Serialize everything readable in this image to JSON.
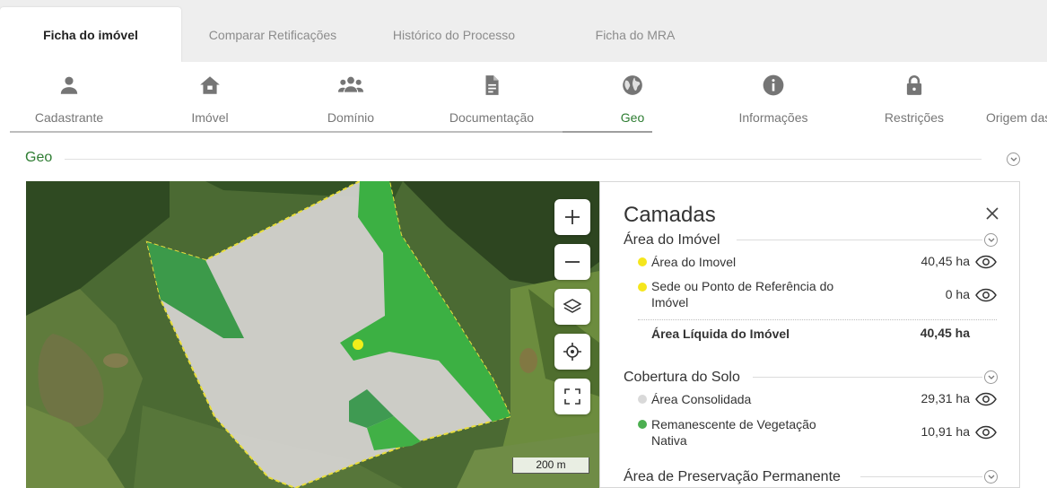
{
  "top_tabs": [
    {
      "label": "Ficha do imóvel",
      "active": true
    },
    {
      "label": "Comparar Retificações",
      "active": false
    },
    {
      "label": "Histórico do Processo",
      "active": false
    },
    {
      "label": "Ficha do MRA",
      "active": false
    }
  ],
  "nav": {
    "items": [
      {
        "label": "Cadastrante",
        "icon": "person-icon"
      },
      {
        "label": "Imóvel",
        "icon": "home-icon"
      },
      {
        "label": "Domínio",
        "icon": "group-icon"
      },
      {
        "label": "Documentação",
        "icon": "document-icon"
      },
      {
        "label": "Geo",
        "icon": "globe-icon",
        "active": true
      },
      {
        "label": "Informações",
        "icon": "info-icon"
      },
      {
        "label": "Restrições",
        "icon": "lock-icon"
      },
      {
        "label": "Origem das",
        "icon": ""
      }
    ]
  },
  "section": {
    "title": "Geo"
  },
  "map": {
    "scale_label": "200 m"
  },
  "panel": {
    "title": "Camadas",
    "groups": [
      {
        "title": "Área do Imóvel",
        "rows": [
          {
            "name": "Área do Imovel",
            "value": "40,45 ha",
            "color": "#f5e61c"
          },
          {
            "name": "Sede ou Ponto de Referência do Imóvel",
            "value": "0 ha",
            "color": "#f5e61c"
          }
        ],
        "total": {
          "name": "Área Líquida do Imóvel",
          "value": "40,45 ha"
        }
      },
      {
        "title": "Cobertura do Solo",
        "rows": [
          {
            "name": "Área Consolidada",
            "value": "29,31 ha",
            "color": "#d9d9d9"
          },
          {
            "name": "Remanescente de Vegetação Nativa",
            "value": "10,91 ha",
            "color": "#4caf50"
          }
        ]
      },
      {
        "title": "Área de Preservação Permanente"
      }
    ]
  },
  "colors": {
    "accent": "#2e7d32",
    "property_area": "#f5e61c",
    "native_vegetation": "#3cb043"
  }
}
